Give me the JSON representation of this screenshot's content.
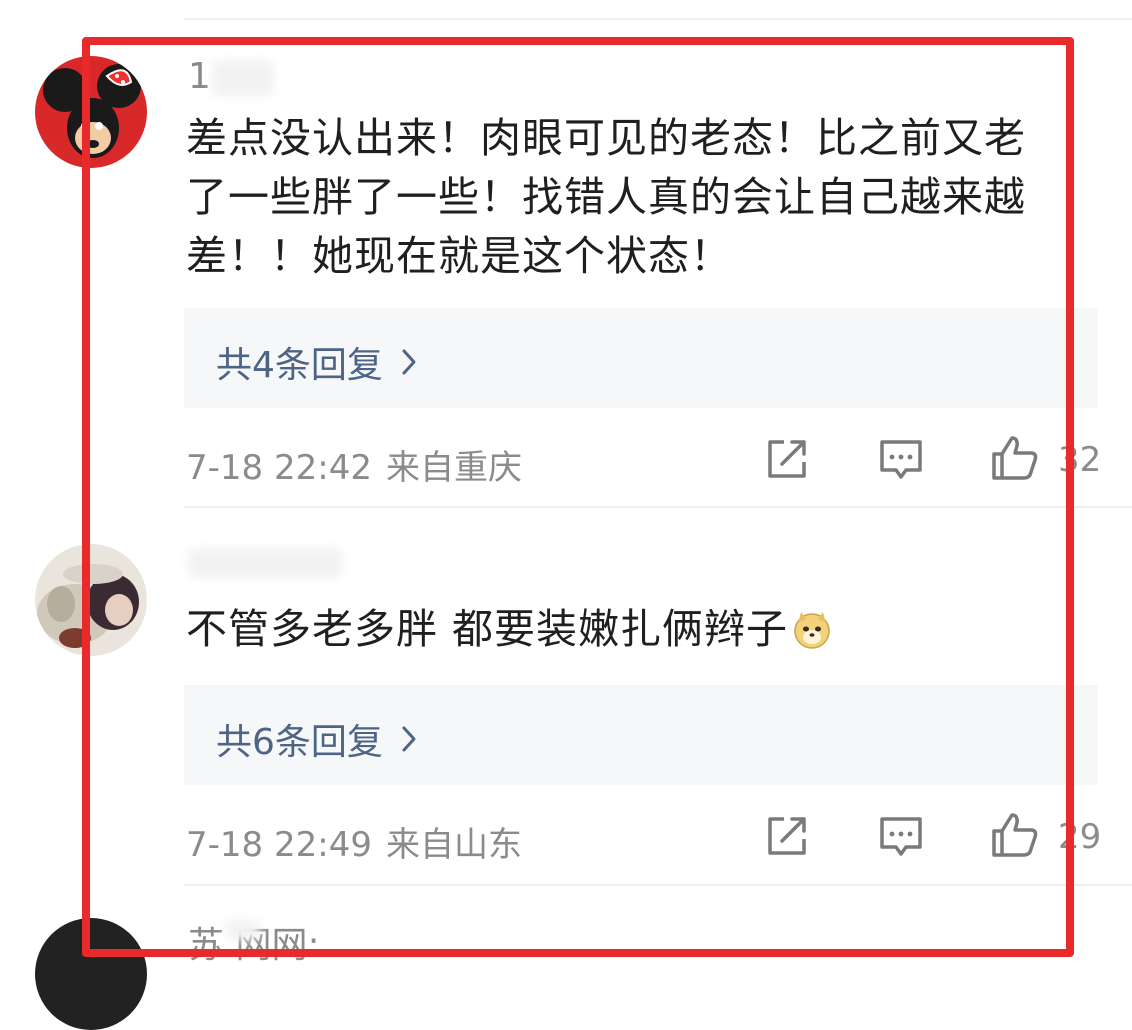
{
  "comments": [
    {
      "username": "1",
      "text_lines": [
        "差点没认出来！肉眼可见的老态！比之前又老",
        "了一些胖了一些！找错人真的会让自己越来越",
        "差！！她现在就是这个状态！"
      ],
      "replies_label": "共4条回复",
      "time": "7-18 22:42",
      "location": "来自重庆",
      "like_count": "32"
    },
    {
      "username": "",
      "text": "不管多老多胖 都要装嫩扎俩辫子",
      "emoji": "doge-emoji",
      "replies_label": "共6条回复",
      "time": "7-18 22:49",
      "location": "来自山东",
      "like_count": "29"
    },
    {
      "username": "苏 网网:"
    }
  ],
  "icons": {
    "share": "share-icon",
    "comment": "comment-icon",
    "like": "thumbs-up-icon",
    "chevron": "chevron-right-icon"
  },
  "colors": {
    "highlight_frame": "#ea2a2a",
    "reply_link": "#4e6486"
  }
}
